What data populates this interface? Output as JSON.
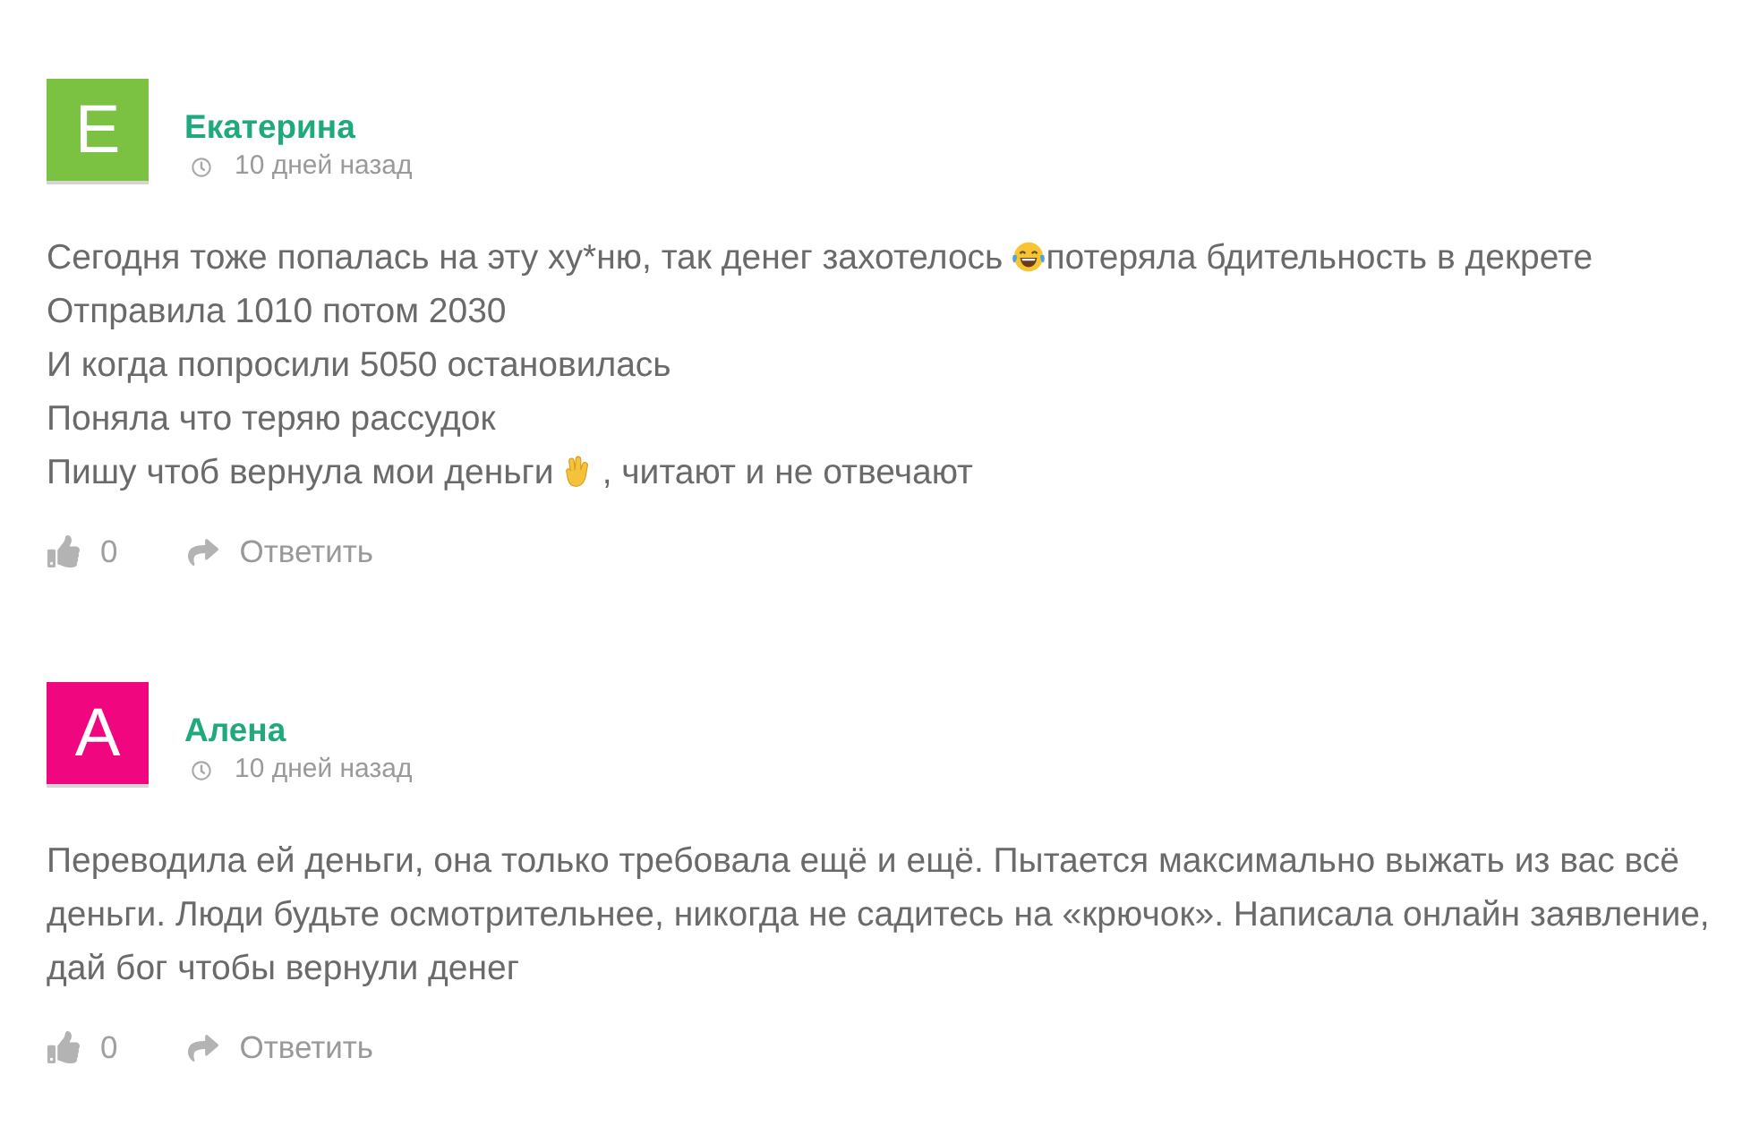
{
  "comments": [
    {
      "author": "Екатерина",
      "avatar": {
        "letter": "Е",
        "color": "#7bc142"
      },
      "time": "10 дней назад",
      "body_lines": [
        [
          {
            "kind": "text",
            "text": "Сегодня тоже попалась на эту ху*ню, так денег захотелось"
          },
          {
            "kind": "laughing"
          },
          {
            "kind": "text",
            "text": "потеряла бдительность в декрете"
          }
        ],
        [
          {
            "kind": "text",
            "text": "Отправила 1010 потом 2030"
          }
        ],
        [
          {
            "kind": "text",
            "text": "И когда попросили 5050 остановилась"
          }
        ],
        [
          {
            "kind": "text",
            "text": "Поняла что теряю рассудок"
          }
        ],
        [
          {
            "kind": "text",
            "text": "Пишу чтоб вернула мои деньги"
          },
          {
            "kind": "hand"
          },
          {
            "kind": "text",
            "text": ", читают и не отвечают"
          }
        ]
      ],
      "likes": "0",
      "reply": "Ответить"
    },
    {
      "author": "Алена",
      "avatar": {
        "letter": "А",
        "color": "#f0077f"
      },
      "time": "10 дней назад",
      "body_lines": [
        [
          {
            "kind": "text",
            "text": "Переводила ей деньги, она только требовала ещё и ещё. Пытается максимально выжать из вас всё"
          }
        ],
        [
          {
            "kind": "text",
            "text": "деньги. Люди будьте осмотрительнее, никогда не садитесь на «крючок». Написала онлайн заявление,"
          }
        ],
        [
          {
            "kind": "text",
            "text": "дай бог чтобы вернули денег"
          }
        ]
      ],
      "likes": "0",
      "reply": "Ответить"
    }
  ]
}
